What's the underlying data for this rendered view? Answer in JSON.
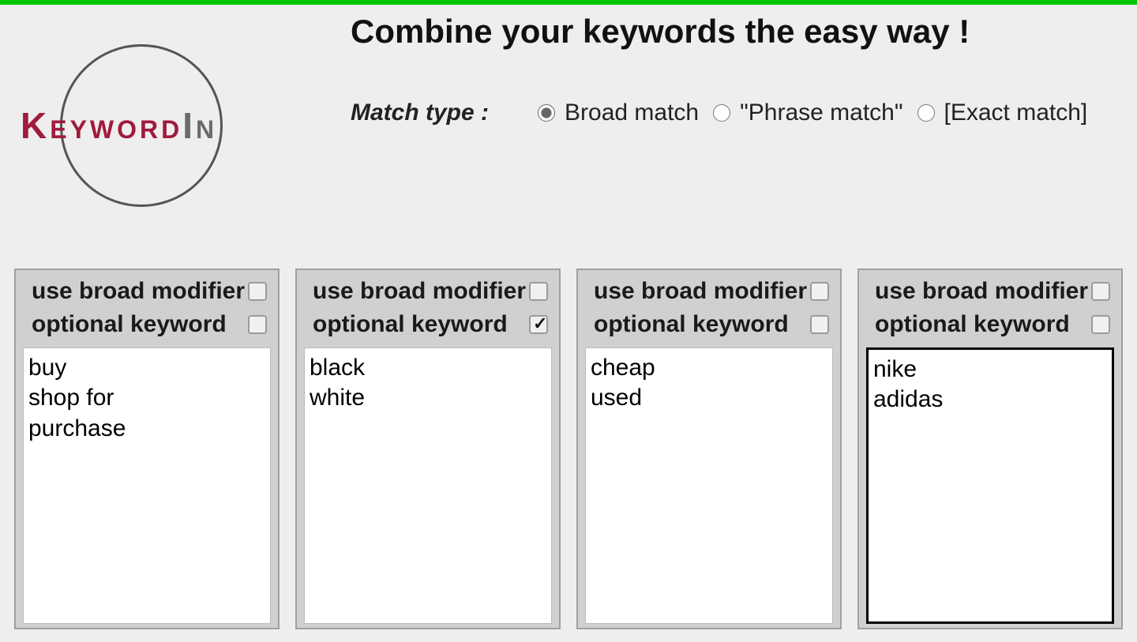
{
  "logo": {
    "brand1": "Keyword",
    "brand2": "In"
  },
  "title": "Combine your keywords the easy way !",
  "match": {
    "label": "Match type :",
    "options": [
      {
        "label": "Broad match",
        "selected": true
      },
      {
        "label": "\"Phrase match\"",
        "selected": false
      },
      {
        "label": "[Exact match]",
        "selected": false
      }
    ]
  },
  "columns": [
    {
      "broad_label": "use broad modifier",
      "broad_checked": false,
      "optional_label": "optional keyword",
      "optional_checked": false,
      "value": "buy\nshop for\npurchase",
      "focused": false
    },
    {
      "broad_label": "use broad modifier",
      "broad_checked": false,
      "optional_label": "optional keyword",
      "optional_checked": true,
      "value": "black\nwhite",
      "focused": false
    },
    {
      "broad_label": "use broad modifier",
      "broad_checked": false,
      "optional_label": "optional keyword",
      "optional_checked": false,
      "value": "cheap\nused",
      "focused": false
    },
    {
      "broad_label": "use broad modifier",
      "broad_checked": false,
      "optional_label": "optional keyword",
      "optional_checked": false,
      "value": "nike\nadidas",
      "focused": true
    }
  ]
}
